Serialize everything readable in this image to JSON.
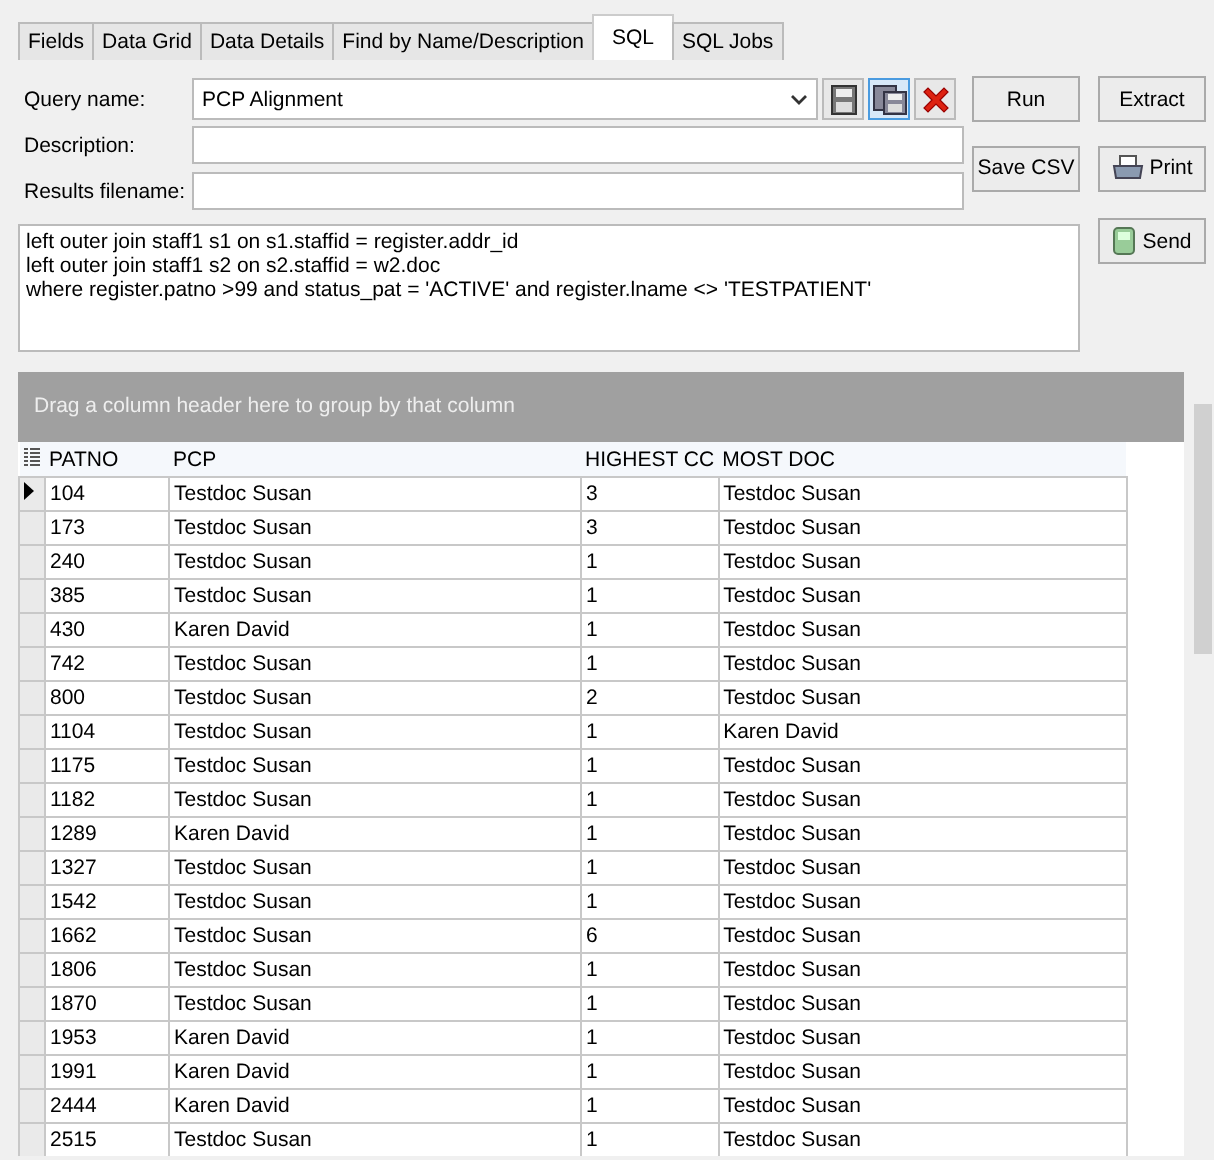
{
  "tabs": [
    {
      "label": "Fields",
      "selected": false
    },
    {
      "label": "Data Grid",
      "selected": false
    },
    {
      "label": "Data Details",
      "selected": false
    },
    {
      "label": "Find by Name/Description",
      "selected": false
    },
    {
      "label": "SQL",
      "selected": true
    },
    {
      "label": "SQL Jobs",
      "selected": false
    }
  ],
  "form": {
    "query_name_label": "Query name:",
    "query_name": "PCP Alignment",
    "description_label": "Description:",
    "results_filename_label": "Results filename:"
  },
  "buttons": {
    "run": "Run",
    "extract": "Extract",
    "save_csv": "Save CSV",
    "print": "Print",
    "send": "Send"
  },
  "sql_text": [
    "left outer join staff1 s1 on s1.staffid = register.addr_id",
    "left outer join staff1 s2 on s2.staffid = w2.doc",
    "where register.patno >99 and status_pat = 'ACTIVE' and register.lname <> 'TESTPATIENT'"
  ],
  "grid": {
    "group_panel": "Drag a column header here to group by that column",
    "columns": [
      "PATNO",
      "PCP",
      "HIGHEST CC",
      "MOST DOC"
    ],
    "rows": [
      {
        "current": true,
        "cells": [
          "104",
          "Testdoc Susan",
          "3",
          "Testdoc Susan"
        ]
      },
      {
        "current": false,
        "cells": [
          "173",
          "Testdoc Susan",
          "3",
          "Testdoc Susan"
        ]
      },
      {
        "current": false,
        "cells": [
          "240",
          "Testdoc Susan",
          "1",
          "Testdoc Susan"
        ]
      },
      {
        "current": false,
        "cells": [
          "385",
          "Testdoc Susan",
          "1",
          "Testdoc Susan"
        ]
      },
      {
        "current": false,
        "cells": [
          "430",
          "Karen David",
          "1",
          "Testdoc Susan"
        ]
      },
      {
        "current": false,
        "cells": [
          "742",
          "Testdoc Susan",
          "1",
          "Testdoc Susan"
        ]
      },
      {
        "current": false,
        "cells": [
          "800",
          "Testdoc Susan",
          "2",
          "Testdoc Susan"
        ]
      },
      {
        "current": false,
        "cells": [
          "1104",
          "Testdoc Susan",
          "1",
          "Karen David"
        ]
      },
      {
        "current": false,
        "cells": [
          "1175",
          "Testdoc Susan",
          "1",
          "Testdoc Susan"
        ]
      },
      {
        "current": false,
        "cells": [
          "1182",
          "Testdoc Susan",
          "1",
          "Testdoc Susan"
        ]
      },
      {
        "current": false,
        "cells": [
          "1289",
          "Karen David",
          "1",
          "Testdoc Susan"
        ]
      },
      {
        "current": false,
        "cells": [
          "1327",
          "Testdoc Susan",
          "1",
          "Testdoc Susan"
        ]
      },
      {
        "current": false,
        "cells": [
          "1542",
          "Testdoc Susan",
          "1",
          "Testdoc Susan"
        ]
      },
      {
        "current": false,
        "cells": [
          "1662",
          "Testdoc Susan",
          "6",
          "Testdoc Susan"
        ]
      },
      {
        "current": false,
        "cells": [
          "1806",
          "Testdoc Susan",
          "1",
          "Testdoc Susan"
        ]
      },
      {
        "current": false,
        "cells": [
          "1870",
          "Testdoc Susan",
          "1",
          "Testdoc Susan"
        ]
      },
      {
        "current": false,
        "cells": [
          "1953",
          "Karen David",
          "1",
          "Testdoc Susan"
        ]
      },
      {
        "current": false,
        "cells": [
          "1991",
          "Karen David",
          "1",
          "Testdoc Susan"
        ]
      },
      {
        "current": false,
        "cells": [
          "2444",
          "Karen David",
          "1",
          "Testdoc Susan"
        ]
      },
      {
        "current": false,
        "cells": [
          "2515",
          "Testdoc Susan",
          "1",
          "Testdoc Susan"
        ]
      }
    ]
  }
}
